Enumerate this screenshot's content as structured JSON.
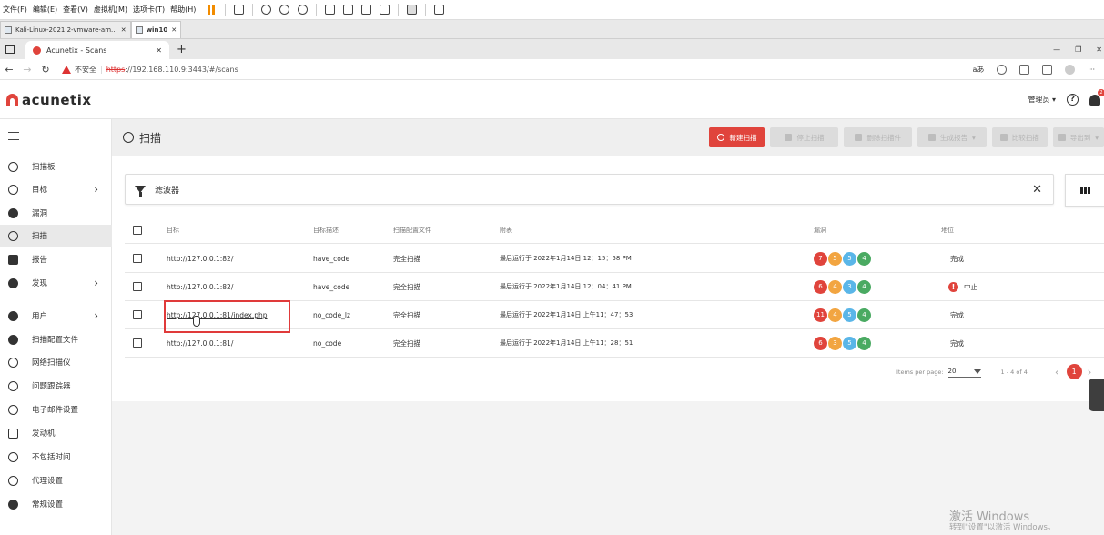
{
  "vm_menu": [
    "文件(F)",
    "编辑(E)",
    "查看(V)",
    "虚拟机(M)",
    "选项卡(T)",
    "帮助(H)"
  ],
  "vm_tabs": [
    {
      "label": "Kali-Linux-2021.2-vmware-am..."
    },
    {
      "label": "win10"
    }
  ],
  "browser": {
    "tab_title": "Acunetix - Scans",
    "insecure_label": "不安全",
    "url_scheme": "https",
    "url_rest": "://192.168.110.9:3443/#/scans"
  },
  "app": {
    "logo_text": "acunetix",
    "user_label": "管理员",
    "notification_count": "2"
  },
  "sidebar": {
    "items": [
      {
        "label": "扫描板",
        "chevron": false
      },
      {
        "label": "目标",
        "chevron": true
      },
      {
        "label": "漏洞",
        "chevron": false
      },
      {
        "label": "扫描",
        "chevron": false,
        "active": true
      },
      {
        "label": "报告",
        "chevron": false
      },
      {
        "label": "发现",
        "chevron": true
      },
      {
        "label": "用户",
        "chevron": true
      },
      {
        "label": "扫描配置文件",
        "chevron": false
      },
      {
        "label": "网络扫描仪",
        "chevron": false
      },
      {
        "label": "问题跟踪器",
        "chevron": false
      },
      {
        "label": "电子邮件设置",
        "chevron": false
      },
      {
        "label": "发动机",
        "chevron": false
      },
      {
        "label": "不包括时间",
        "chevron": false
      },
      {
        "label": "代理设置",
        "chevron": false
      },
      {
        "label": "常规设置",
        "chevron": false
      }
    ]
  },
  "page": {
    "title": "扫描",
    "buttons": {
      "new_scan": "新建扫描",
      "stop_scan": "停止扫描",
      "delete_scan": "删除扫描件",
      "generate_report": "生成报告",
      "compare_scans": "比较扫描",
      "export": "导出到"
    },
    "filter_label": "滤波器"
  },
  "table": {
    "headers": [
      "目标",
      "目标描述",
      "扫描配置文件",
      "附表",
      "漏洞",
      "地位"
    ],
    "rows": [
      {
        "target": "http://127.0.0.1:82/",
        "desc": "have_code",
        "profile": "完全扫描",
        "schedule": "最后运行于 2022年1月14日 12：15：58 PM",
        "vulns": [
          "7",
          "5",
          "5",
          "4"
        ],
        "status": "完成",
        "aborted": false
      },
      {
        "target": "http://127.0.0.1:82/",
        "desc": "have_code",
        "profile": "完全扫描",
        "schedule": "最后运行于 2022年1月14日 12：04：41 PM",
        "vulns": [
          "6",
          "4",
          "3",
          "4"
        ],
        "status": "中止",
        "aborted": true
      },
      {
        "target": "http://127.0.0.1:81/index.php",
        "desc": "no_code_lz",
        "profile": "完全扫描",
        "schedule": "最后运行于 2022年1月14日 上午11：47：53",
        "vulns": [
          "11",
          "4",
          "5",
          "4"
        ],
        "status": "完成",
        "aborted": false
      },
      {
        "target": "http://127.0.0.1:81/",
        "desc": "no_code",
        "profile": "完全扫描",
        "schedule": "最后运行于 2022年1月14日 上午11：28：51",
        "vulns": [
          "6",
          "3",
          "5",
          "4"
        ],
        "status": "完成",
        "aborted": false
      }
    ]
  },
  "pagination": {
    "items_per_page_label": "Items per page:",
    "items_per_page": "20",
    "range": "1 - 4 of 4",
    "current_page": "1"
  },
  "watermark": {
    "line1": "激活 Windows",
    "line2": "转到\"设置\"以激活 Windows。"
  },
  "colors": {
    "accent": "#e0443c",
    "critical": "#e0443c",
    "high": "#f2a541",
    "medium": "#5ab6e8",
    "low": "#4aaa62"
  }
}
